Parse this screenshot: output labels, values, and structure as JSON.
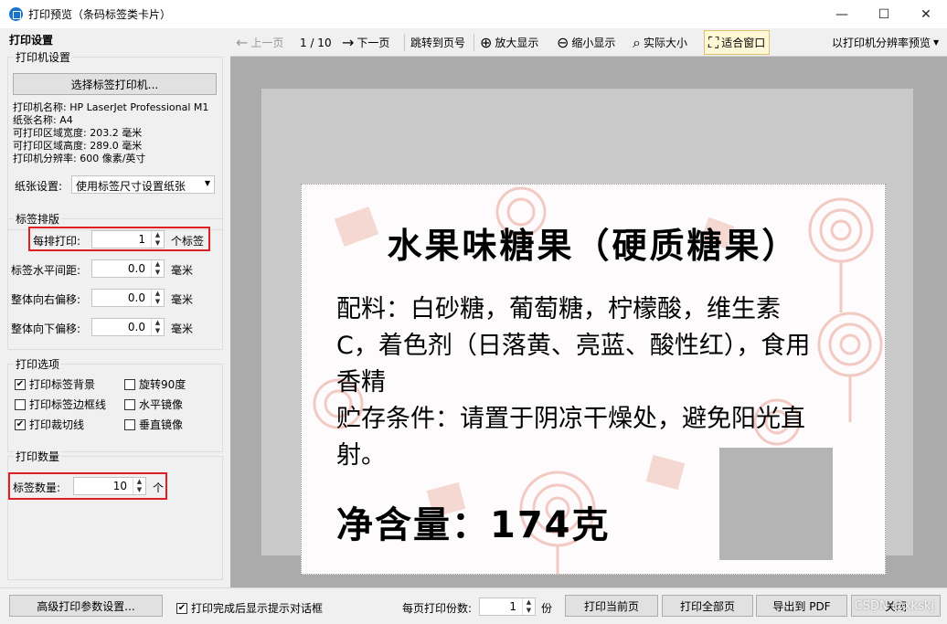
{
  "window": {
    "title": "打印预览（条码标签类卡片）",
    "minimize": "—",
    "maximize": "☐",
    "close": "✕"
  },
  "left_panel": {
    "header": "打印设置",
    "printer_group": {
      "title": "打印机设置",
      "select_button": "选择标签打印机...",
      "info": [
        "打印机名称: HP LaserJet Professional M1",
        "纸张名称: A4",
        "可打印区域宽度: 203.2 毫米",
        "可打印区域高度: 289.0 毫米",
        "打印机分辨率: 600 像素/英寸"
      ],
      "paper_label": "纸张设置:",
      "paper_value": "使用标签尺寸设置纸张"
    },
    "layout_group": {
      "title": "标签排版",
      "per_row_label": "每排打印:",
      "per_row_value": "1",
      "per_row_unit": "个标签",
      "h_gap_label": "标签水平间距:",
      "h_gap_value": "0.0",
      "right_offset_label": "整体向右偏移:",
      "right_offset_value": "0.0",
      "down_offset_label": "整体向下偏移:",
      "down_offset_value": "0.0",
      "mm_unit": "毫米"
    },
    "options_group": {
      "title": "打印选项",
      "print_bg": "打印标签背景",
      "print_border": "打印标签边框线",
      "print_cut": "打印裁切线",
      "rotate90": "旋转90度",
      "mirror_h": "水平镜像",
      "mirror_v": "垂直镜像"
    },
    "qty_group": {
      "title": "打印数量",
      "qty_label": "标签数量:",
      "qty_value": "10",
      "qty_unit": "个"
    }
  },
  "toolbar": {
    "prev": "上一页",
    "page_indicator": "1 / 10",
    "next": "下一页",
    "goto": "跳转到页号",
    "zoom_in": "放大显示",
    "zoom_out": "缩小显示",
    "actual": "实际大小",
    "fit": "适合窗口",
    "resolution": "以打印机分辨率预览"
  },
  "label_card": {
    "title": "水果味糖果（硬质糖果）",
    "body": "配料：白砂糖，葡萄糖，柠檬酸，维生素C，着色剂（日落黄、亮蓝、酸性红），食用香精\n贮存条件：请置于阴凉干燥处，避免阳光直射。",
    "net": "净含量：174克"
  },
  "bottom": {
    "advanced_button": "高级打印参数设置...",
    "show_dialog_label": "打印完成后显示提示对话框",
    "copies_label": "每页打印份数:",
    "copies_value": "1",
    "copies_unit": "份",
    "print_current": "打印当前页",
    "print_all": "打印全部页",
    "export_pdf": "导出到 PDF",
    "close": "关闭",
    "watermark": "CSDN @xkskj"
  },
  "colors": {
    "highlight_border": "#e02020",
    "active_tool_bg": "#fff8d6"
  }
}
